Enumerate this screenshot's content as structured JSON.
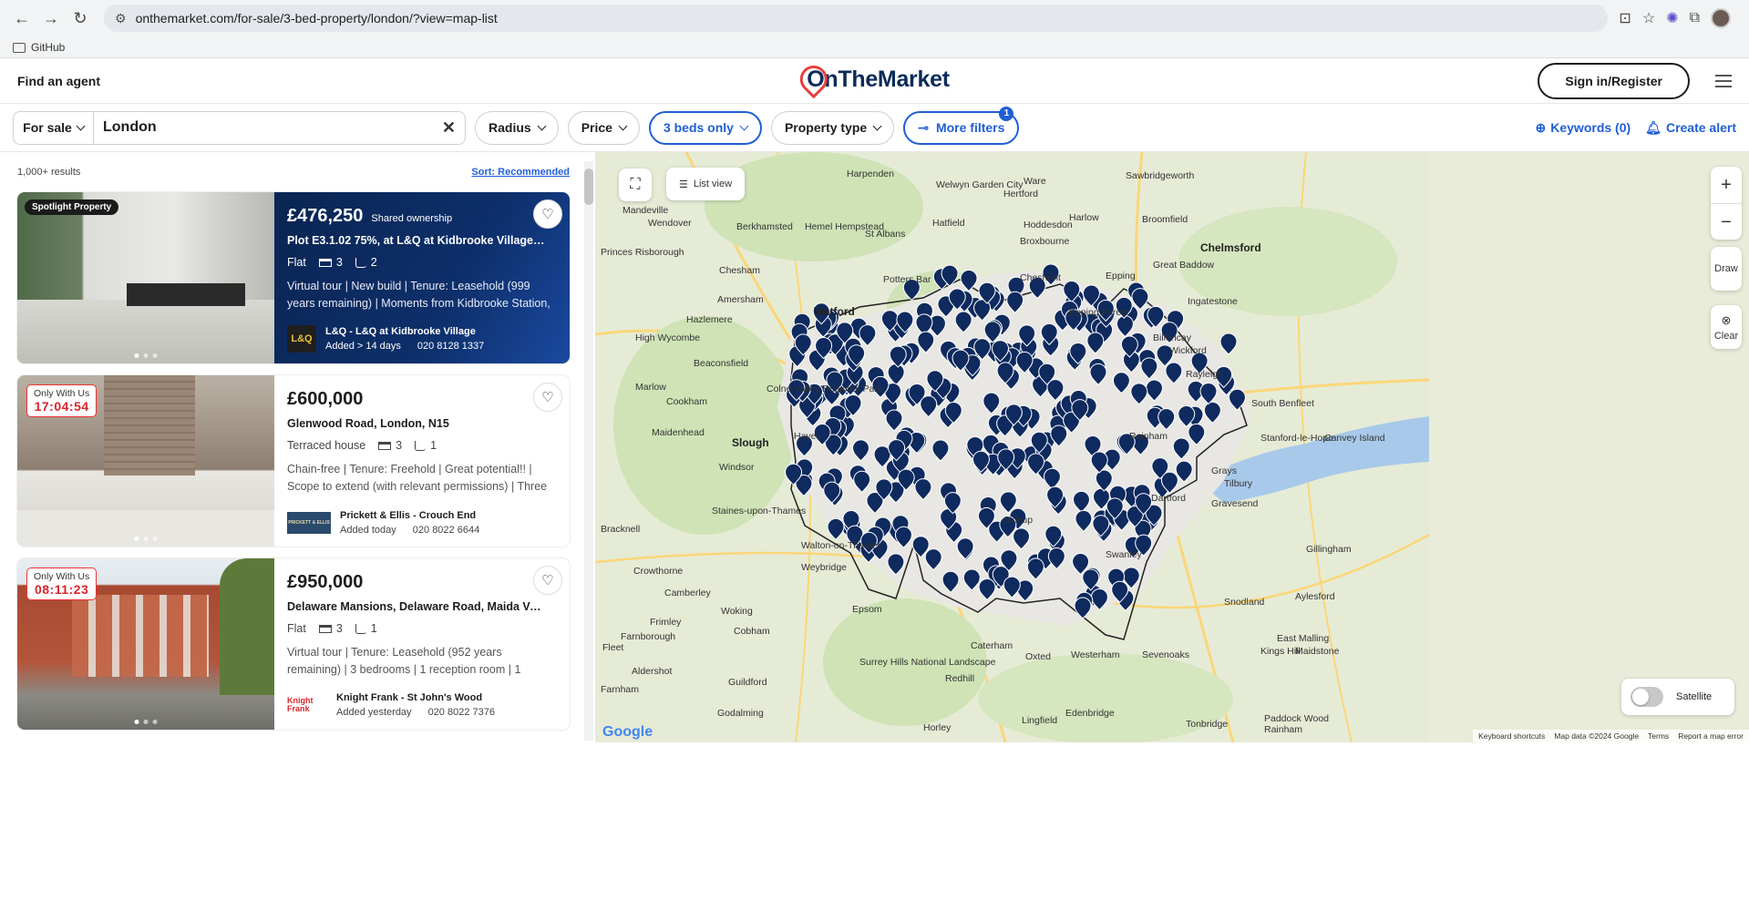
{
  "browser": {
    "url": "onthemarket.com/for-sale/3-bed-property/london/?view=map-list",
    "bookmark": "GitHub"
  },
  "header": {
    "find_agent": "Find an agent",
    "logo": "OnTheMarket",
    "sign_in": "Sign in/Register"
  },
  "filters": {
    "for_sale": "For sale",
    "location": "London",
    "radius": "Radius",
    "price": "Price",
    "beds": "3 beds only",
    "property_type": "Property type",
    "more_filters": "More filters",
    "more_filters_count": "1",
    "keywords": "Keywords (0)",
    "create_alert": "Create alert"
  },
  "results": {
    "count": "1,000+ results",
    "sort": "Sort: Recommended"
  },
  "listings": [
    {
      "label": "Spotlight Property",
      "price": "£476,250",
      "ownership": "Shared ownership",
      "title": "Plot E3.1.02 75%, at L&Q at Kidbrooke Village 6 ...",
      "type": "Flat",
      "beds": "3",
      "baths": "2",
      "desc": "Virtual tour | New build | Tenure: Leasehold (999 years remaining) | Moments from Kidbrooke Station, Zone...",
      "agent_logo": "L&Q",
      "agent": "L&Q - L&Q at Kidbrooke Village",
      "added": "Added > 14 days",
      "phone": "020 8128 1337"
    },
    {
      "badge_top": "Only With Us",
      "badge_time": "17:04:54",
      "price": "£600,000",
      "title": "Glenwood Road, London, N15",
      "type": "Terraced house",
      "beds": "3",
      "baths": "1",
      "desc": "Chain-free | Tenure: Freehold | Great potential!! | Scope to extend (with relevant permissions) | Three reception...",
      "agent_logo": "PRICKETT & ELLIS",
      "agent": "Prickett & Ellis - Crouch End",
      "added": "Added today",
      "phone": "020 8022 6644"
    },
    {
      "badge_top": "Only With Us",
      "badge_time": "08:11:23",
      "price": "£950,000",
      "title": "Delaware Mansions, Delaware Road, Maida Vale...",
      "type": "Flat",
      "beds": "3",
      "baths": "1",
      "desc": "Virtual tour | Tenure: Leasehold (952 years remaining) | 3 bedrooms | 1 reception room | 1 bathroom",
      "agent_logo": "Knight Frank",
      "agent": "Knight Frank - St John's Wood",
      "added": "Added yesterday",
      "phone": "020 8022 7376"
    }
  ],
  "map": {
    "list_view": "List view",
    "draw": "Draw",
    "clear": "Clear",
    "satellite": "Satellite",
    "footer": [
      "Keyboard shortcuts",
      "Map data ©2024 Google",
      "Terms",
      "Report a map error"
    ],
    "google": "Google",
    "places": [
      "Harpenden",
      "Welwyn Garden City",
      "Ware",
      "Sawbridgeworth",
      "Mandeville",
      "Wendover",
      "Berkhamsted",
      "Hemel Hempstead",
      "St Albans",
      "Hatfield",
      "Hertford",
      "Hoddesdon",
      "Harlow",
      "Broomfield",
      "Chelmsford",
      "Princes Risborough",
      "Chesham",
      "Broxbourne",
      "Epping",
      "Great Baddow",
      "Amersham",
      "Watford",
      "Potters Bar",
      "Cheshunt",
      "Ingatestone",
      "High Wycombe",
      "Hazlemere",
      "Epping Forest",
      "Billericay",
      "Beaconsfield",
      "Wickford",
      "Rayleigh",
      "Marlow",
      "Cookham",
      "Colne Valley Regional Park",
      "South Benfleet",
      "Maidenhead",
      "Slough",
      "Hayes",
      "Rainham",
      "Stanford-le-Hope",
      "Canvey Island",
      "Windsor",
      "Grays",
      "Tilbury",
      "Dartford",
      "Gravesend",
      "Staines-upon-Thames",
      "Bracknell",
      "Sidcup",
      "Swanley",
      "Walton-on-Thames",
      "Weybridge",
      "Gillingham",
      "Crowthorne",
      "Camberley",
      "Woking",
      "Cobham",
      "Epsom",
      "Snodland",
      "Frimley",
      "Aylesford",
      "Farnborough",
      "East Malling",
      "Kings Hill",
      "Maidstone",
      "Fleet",
      "Aldershot",
      "Guildford",
      "Surrey Hills National Landscape",
      "Redhill",
      "Caterham",
      "Westerham",
      "Sevenoaks",
      "Oxted",
      "Farnham",
      "Godalming",
      "Horley",
      "Lingfield",
      "Edenbridge",
      "Tonbridge",
      "Paddock Wood",
      "Rainham"
    ]
  },
  "colors": {
    "accent": "#1f5fd6",
    "brand": "#0b2b5a",
    "pin": "#0e2a5e",
    "logo_red": "#e8413c"
  }
}
